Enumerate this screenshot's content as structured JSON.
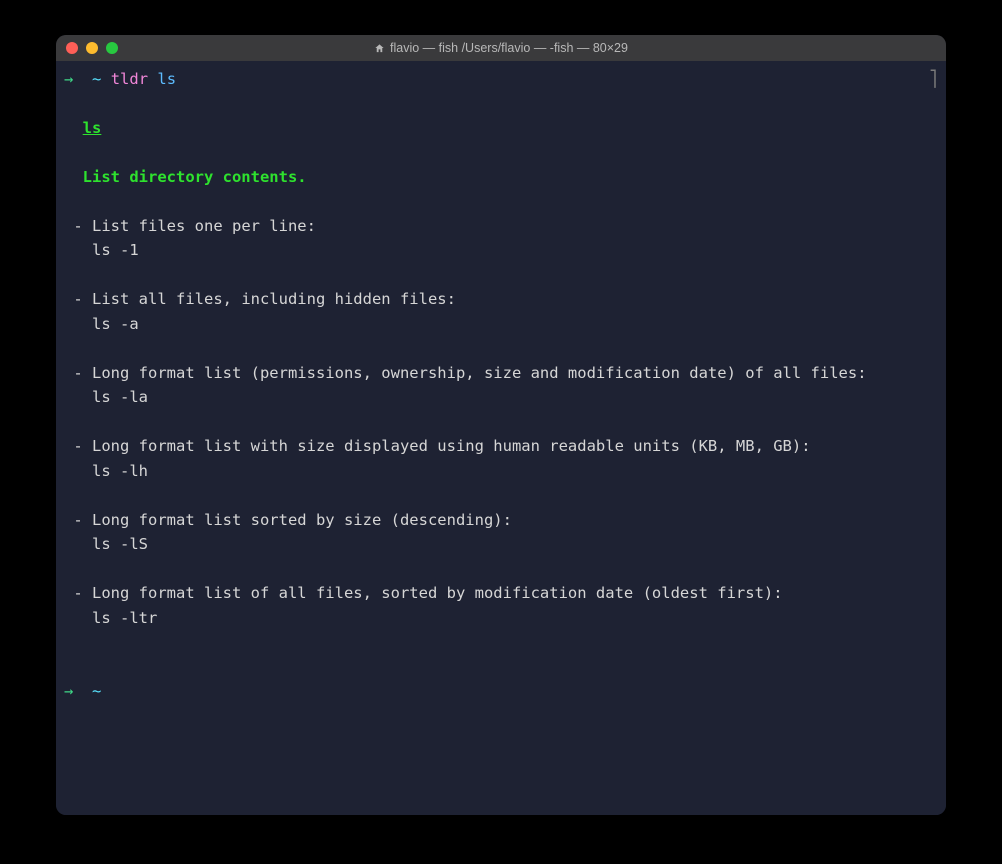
{
  "window": {
    "title": "flavio — fish /Users/flavio — -fish — 80×29"
  },
  "prompt1": {
    "arrow": "→",
    "tilde": "~",
    "command": "tldr",
    "arg": "ls"
  },
  "output": {
    "heading": "ls",
    "summary": "List directory contents.",
    "items": [
      {
        "desc": " - List files one per line:",
        "code": "   ls -1"
      },
      {
        "desc": " - List all files, including hidden files:",
        "code": "   ls -a"
      },
      {
        "desc": " - Long format list (permissions, ownership, size and modification date) of all files:",
        "code": "   ls -la"
      },
      {
        "desc": " - Long format list with size displayed using human readable units (KB, MB, GB):",
        "code": "   ls -lh"
      },
      {
        "desc": " - Long format list sorted by size (descending):",
        "code": "   ls -lS"
      },
      {
        "desc": " - Long format list of all files, sorted by modification date (oldest first):",
        "code": "   ls -ltr"
      }
    ]
  },
  "prompt2": {
    "arrow": "→",
    "tilde": "~"
  },
  "bracket": "⎤"
}
